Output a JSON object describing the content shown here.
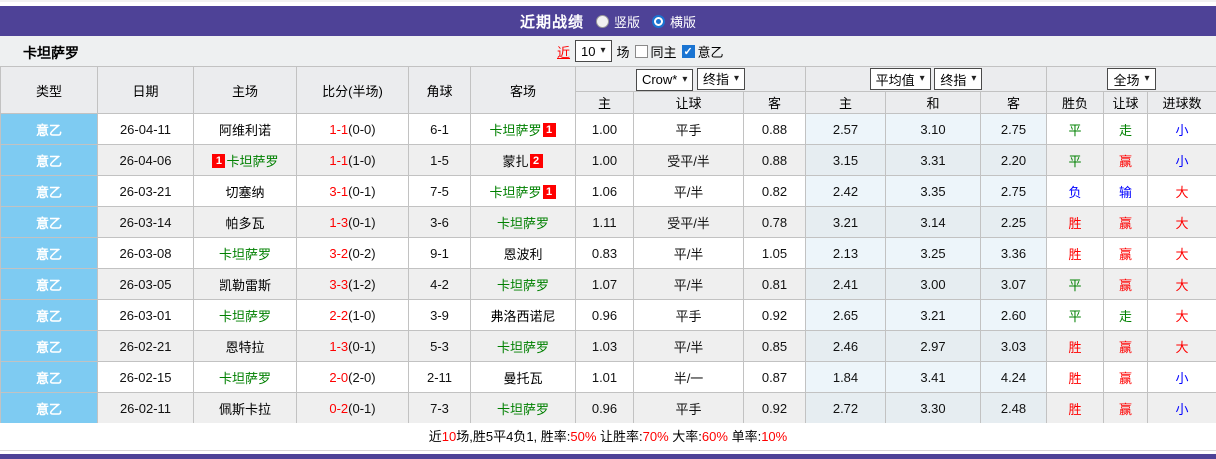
{
  "header": {
    "title": "近期战绩",
    "radio_vertical": "竖版",
    "radio_horizontal": "横版",
    "selected_radio": "横版"
  },
  "toolbar": {
    "team": "卡坦萨罗",
    "near_label": "近",
    "games_select_value": "10",
    "games_label": "场",
    "same_home_label": "同主",
    "same_home_checked": false,
    "league_filter_label": "意乙",
    "league_filter_checked": true,
    "check_glyph": "✓"
  },
  "table": {
    "left_headers": [
      "类型",
      "日期",
      "主场",
      "比分(半场)",
      "角球",
      "客场"
    ],
    "group1_selects": [
      "Crow*",
      "终指"
    ],
    "group2_selects": [
      "平均值",
      "终指"
    ],
    "group3_select": "全场",
    "sub_headers": [
      "主",
      "让球",
      "客",
      "主",
      "和",
      "客",
      "胜负",
      "让球",
      "进球数"
    ],
    "rows": [
      {
        "league": "意乙",
        "date": "26-04-11",
        "home": {
          "name": "阿维利诺",
          "color": "#000000"
        },
        "score": "1-1",
        "half": "(0-0)",
        "corner": "6-1",
        "away": {
          "name": "卡坦萨罗",
          "color": "#008000",
          "badge": "1",
          "badge_pos": "after"
        },
        "asia": [
          "1.00",
          "平手",
          "0.88"
        ],
        "avg": [
          "2.57",
          "3.10",
          "2.75"
        ],
        "outcome": [
          "平",
          "走",
          "小"
        ]
      },
      {
        "league": "意乙",
        "date": "26-04-06",
        "home": {
          "name": "卡坦萨罗",
          "color": "#008000",
          "badge": "1",
          "badge_pos": "before"
        },
        "score": "1-1",
        "half": "(1-0)",
        "corner": "1-5",
        "away": {
          "name": "蒙扎",
          "color": "#000000",
          "badge": "2",
          "badge_pos": "after"
        },
        "asia": [
          "1.00",
          "受平/半",
          "0.88"
        ],
        "avg": [
          "3.15",
          "3.31",
          "2.20"
        ],
        "outcome": [
          "平",
          "赢",
          "小"
        ]
      },
      {
        "league": "意乙",
        "date": "26-03-21",
        "home": {
          "name": "切塞纳",
          "color": "#000000"
        },
        "score": "3-1",
        "half": "(0-1)",
        "corner": "7-5",
        "away": {
          "name": "卡坦萨罗",
          "color": "#008000",
          "badge": "1",
          "badge_pos": "after"
        },
        "asia": [
          "1.06",
          "平/半",
          "0.82"
        ],
        "avg": [
          "2.42",
          "3.35",
          "2.75"
        ],
        "outcome": [
          "负",
          "输",
          "大"
        ]
      },
      {
        "league": "意乙",
        "date": "26-03-14",
        "home": {
          "name": "帕多瓦",
          "color": "#000000"
        },
        "score": "1-3",
        "half": "(0-1)",
        "corner": "3-6",
        "away": {
          "name": "卡坦萨罗",
          "color": "#008000"
        },
        "asia": [
          "1.11",
          "受平/半",
          "0.78"
        ],
        "avg": [
          "3.21",
          "3.14",
          "2.25"
        ],
        "outcome": [
          "胜",
          "赢",
          "大"
        ]
      },
      {
        "league": "意乙",
        "date": "26-03-08",
        "home": {
          "name": "卡坦萨罗",
          "color": "#008000"
        },
        "score": "3-2",
        "half": "(0-2)",
        "corner": "9-1",
        "away": {
          "name": "恩波利",
          "color": "#000000"
        },
        "asia": [
          "0.83",
          "平/半",
          "1.05"
        ],
        "avg": [
          "2.13",
          "3.25",
          "3.36"
        ],
        "outcome": [
          "胜",
          "赢",
          "大"
        ]
      },
      {
        "league": "意乙",
        "date": "26-03-05",
        "home": {
          "name": "凯勒雷斯",
          "color": "#000000"
        },
        "score": "3-3",
        "half": "(1-2)",
        "corner": "4-2",
        "away": {
          "name": "卡坦萨罗",
          "color": "#008000"
        },
        "asia": [
          "1.07",
          "平/半",
          "0.81"
        ],
        "avg": [
          "2.41",
          "3.00",
          "3.07"
        ],
        "outcome": [
          "平",
          "赢",
          "大"
        ]
      },
      {
        "league": "意乙",
        "date": "26-03-01",
        "home": {
          "name": "卡坦萨罗",
          "color": "#008000"
        },
        "score": "2-2",
        "half": "(1-0)",
        "corner": "3-9",
        "away": {
          "name": "弗洛西诺尼",
          "color": "#000000"
        },
        "asia": [
          "0.96",
          "平手",
          "0.92"
        ],
        "avg": [
          "2.65",
          "3.21",
          "2.60"
        ],
        "outcome": [
          "平",
          "走",
          "大"
        ]
      },
      {
        "league": "意乙",
        "date": "26-02-21",
        "home": {
          "name": "恩特拉",
          "color": "#000000"
        },
        "score": "1-3",
        "half": "(0-1)",
        "corner": "5-3",
        "away": {
          "name": "卡坦萨罗",
          "color": "#008000"
        },
        "asia": [
          "1.03",
          "平/半",
          "0.85"
        ],
        "avg": [
          "2.46",
          "2.97",
          "3.03"
        ],
        "outcome": [
          "胜",
          "赢",
          "大"
        ]
      },
      {
        "league": "意乙",
        "date": "26-02-15",
        "home": {
          "name": "卡坦萨罗",
          "color": "#008000"
        },
        "score": "2-0",
        "half": "(2-0)",
        "corner": "2-11",
        "away": {
          "name": "曼托瓦",
          "color": "#000000"
        },
        "asia": [
          "1.01",
          "半/一",
          "0.87"
        ],
        "avg": [
          "1.84",
          "3.41",
          "4.24"
        ],
        "outcome": [
          "胜",
          "赢",
          "小"
        ]
      },
      {
        "league": "意乙",
        "date": "26-02-11",
        "home": {
          "name": "佩斯卡拉",
          "color": "#000000"
        },
        "score": "0-2",
        "half": "(0-1)",
        "corner": "7-3",
        "away": {
          "name": "卡坦萨罗",
          "color": "#008000"
        },
        "asia": [
          "0.96",
          "平手",
          "0.92"
        ],
        "avg": [
          "2.72",
          "3.30",
          "2.48"
        ],
        "outcome": [
          "胜",
          "赢",
          "小"
        ]
      }
    ]
  },
  "status_color_map": {
    "胜": "#ff0000",
    "平": "#008000",
    "负": "#0000ff",
    "赢": "#ff0000",
    "走": "#008000",
    "输": "#0000ff",
    "大": "#ff0000",
    "小": "#0000ff"
  },
  "footer": {
    "segments": [
      {
        "text": "近",
        "color": "#000000"
      },
      {
        "text": "10",
        "color": "#ff0000"
      },
      {
        "text": "场,胜5平4负1, 胜率:",
        "color": "#000000"
      },
      {
        "text": "50%",
        "color": "#ff0000"
      },
      {
        "text": " 让胜率:",
        "color": "#000000"
      },
      {
        "text": "70%",
        "color": "#ff0000"
      },
      {
        "text": " 大率:",
        "color": "#000000"
      },
      {
        "text": "60%",
        "color": "#ff0000"
      },
      {
        "text": " 单率:",
        "color": "#000000"
      },
      {
        "text": "10%",
        "color": "#ff0000"
      }
    ]
  },
  "colors": {
    "accent_purple": "#4e4297",
    "league_cell_cyan": "#7ecbf2",
    "row_alt_gray": "#efefef",
    "avg_col_tint": "#edf5fa",
    "badge_red": "#ff0000"
  }
}
